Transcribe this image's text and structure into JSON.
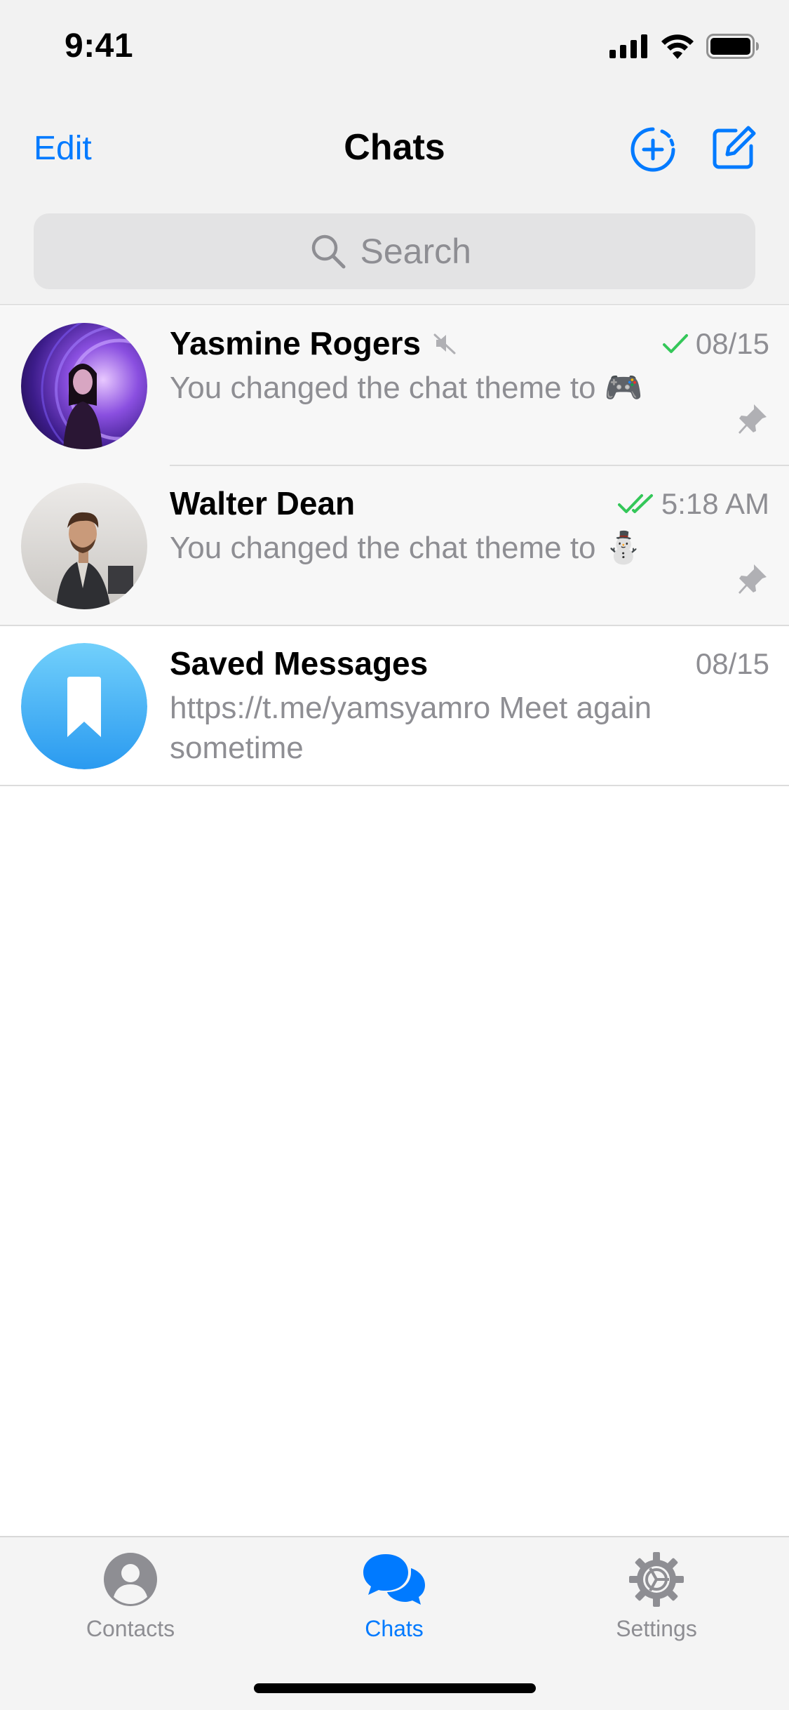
{
  "status_bar": {
    "time": "9:41"
  },
  "nav": {
    "edit_label": "Edit",
    "title": "Chats"
  },
  "search": {
    "placeholder": "Search"
  },
  "chats": [
    {
      "name": "Yasmine Rogers",
      "muted": true,
      "pinned": true,
      "read_status": "sent",
      "time": "08/15",
      "message": "You changed the chat theme to 🎮"
    },
    {
      "name": "Walter Dean",
      "muted": false,
      "pinned": true,
      "read_status": "read",
      "time": "5:18 AM",
      "message": "You changed the chat theme to ⛄"
    },
    {
      "name": "Saved Messages",
      "muted": false,
      "pinned": false,
      "time": "08/15",
      "message": "https://t.me/yamsyamro Meet again sometime"
    }
  ],
  "tabs": [
    {
      "label": "Contacts",
      "icon": "person-circle-icon",
      "active": false
    },
    {
      "label": "Chats",
      "icon": "chat-bubbles-icon",
      "active": true
    },
    {
      "label": "Settings",
      "icon": "gear-icon",
      "active": false
    }
  ],
  "colors": {
    "accent": "#007aff",
    "check_green": "#34c759",
    "secondary_text": "#8e8e93",
    "saved_messages": "#3ba8f5"
  }
}
